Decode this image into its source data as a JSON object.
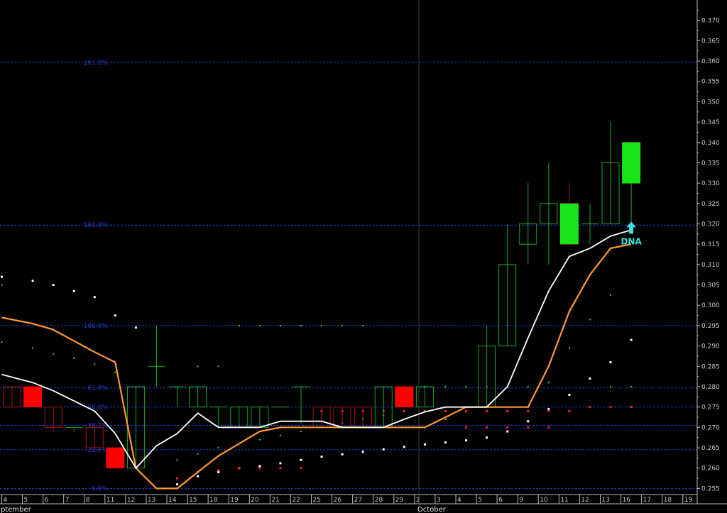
{
  "chart_data": {
    "type": "candlestick",
    "y_axis": {
      "min": 0.2535,
      "max": 0.375,
      "side": "right",
      "ticks": [
        "0.255",
        "0.260",
        "0.265",
        "0.270",
        "0.275",
        "0.280",
        "0.285",
        "0.290",
        "0.295",
        "0.300",
        "0.305",
        "0.310",
        "0.315",
        "0.320",
        "0.325",
        "0.330",
        "0.335",
        "0.340",
        "0.345",
        "0.350",
        "0.355",
        "0.360",
        "0.365",
        "0.370"
      ]
    },
    "x_axis": {
      "labels": [
        "4",
        "5",
        "6",
        "7",
        "8",
        "11",
        "12",
        "13",
        "14",
        "15",
        "18",
        "19",
        "20",
        "21",
        "22",
        "25",
        "26",
        "27",
        "28",
        "29",
        "2",
        "3",
        "4",
        "5",
        "6",
        "9",
        "10",
        "11",
        "12",
        "13",
        "16",
        "17",
        "18",
        "19"
      ],
      "months": [
        {
          "label": "ptember",
          "at": 0
        },
        {
          "label": "October",
          "at": 20
        }
      ]
    },
    "fib_levels": [
      {
        "label": "0.0%",
        "value": 0.255
      },
      {
        "label": "23.6%",
        "value": 0.2645
      },
      {
        "label": "38.2%",
        "value": 0.2705
      },
      {
        "label": "50.0%",
        "value": 0.275
      },
      {
        "label": "61.8%",
        "value": 0.2797
      },
      {
        "label": "100.0%",
        "value": 0.295
      },
      {
        "label": "161.8%",
        "value": 0.3197
      },
      {
        "label": "261.8%",
        "value": 0.3597
      }
    ],
    "candles": [
      {
        "x": 0,
        "o": 0.28,
        "h": 0.28,
        "l": 0.275,
        "c": 0.275
      },
      {
        "x": 1,
        "o": 0.28,
        "h": 0.28,
        "l": 0.275,
        "c": 0.275
      },
      {
        "x": 2,
        "o": 0.275,
        "h": 0.275,
        "l": 0.269,
        "c": 0.27
      },
      {
        "x": 3,
        "o": 0.27,
        "h": 0.27,
        "l": 0.269,
        "c": 0.27
      },
      {
        "x": 4,
        "o": 0.27,
        "h": 0.27,
        "l": 0.265,
        "c": 0.265
      },
      {
        "x": 5,
        "o": 0.265,
        "h": 0.265,
        "l": 0.26,
        "c": 0.26
      },
      {
        "x": 6,
        "o": 0.26,
        "h": 0.28,
        "l": 0.26,
        "c": 0.28
      },
      {
        "x": 7,
        "o": 0.285,
        "h": 0.295,
        "l": 0.28,
        "c": 0.285
      },
      {
        "x": 8,
        "o": 0.28,
        "h": 0.28,
        "l": 0.275,
        "c": 0.28
      },
      {
        "x": 9,
        "o": 0.275,
        "h": 0.28,
        "l": 0.275,
        "c": 0.28
      },
      {
        "x": 10,
        "o": 0.275,
        "h": 0.275,
        "l": 0.27,
        "c": 0.275
      },
      {
        "x": 11,
        "o": 0.27,
        "h": 0.275,
        "l": 0.27,
        "c": 0.275
      },
      {
        "x": 12,
        "o": 0.27,
        "h": 0.275,
        "l": 0.27,
        "c": 0.275
      },
      {
        "x": 13,
        "o": 0.275,
        "h": 0.275,
        "l": 0.275,
        "c": 0.275
      },
      {
        "x": 14,
        "o": 0.28,
        "h": 0.28,
        "l": 0.271,
        "c": 0.28
      },
      {
        "x": 15,
        "o": 0.275,
        "h": 0.275,
        "l": 0.27,
        "c": 0.27
      },
      {
        "x": 16,
        "o": 0.275,
        "h": 0.275,
        "l": 0.27,
        "c": 0.27
      },
      {
        "x": 17,
        "o": 0.275,
        "h": 0.275,
        "l": 0.27,
        "c": 0.27
      },
      {
        "x": 18,
        "o": 0.27,
        "h": 0.28,
        "l": 0.27,
        "c": 0.28
      },
      {
        "x": 19,
        "o": 0.28,
        "h": 0.28,
        "l": 0.275,
        "c": 0.275
      },
      {
        "x": 20,
        "o": 0.275,
        "h": 0.28,
        "l": 0.275,
        "c": 0.28
      },
      {
        "x": 23,
        "o": 0.275,
        "h": 0.295,
        "l": 0.275,
        "c": 0.29
      },
      {
        "x": 24,
        "o": 0.29,
        "h": 0.32,
        "l": 0.29,
        "c": 0.31
      },
      {
        "x": 25,
        "o": 0.315,
        "h": 0.33,
        "l": 0.31,
        "c": 0.32
      },
      {
        "x": 26,
        "o": 0.32,
        "h": 0.335,
        "l": 0.31,
        "c": 0.325
      },
      {
        "x": 27,
        "o": 0.325,
        "h": 0.33,
        "l": 0.315,
        "c": 0.315
      },
      {
        "x": 28,
        "o": 0.32,
        "h": 0.325,
        "l": 0.315,
        "c": 0.32
      },
      {
        "x": 29,
        "o": 0.32,
        "h": 0.345,
        "l": 0.32,
        "c": 0.335
      },
      {
        "x": 30,
        "o": 0.33,
        "h": 0.34,
        "l": 0.32,
        "c": 0.34
      }
    ],
    "highlights": [
      {
        "x": 1,
        "top": 0.28,
        "bottom": 0.275,
        "color": "#ff0000"
      },
      {
        "x": 5,
        "top": 0.265,
        "bottom": 0.26,
        "color": "#ff0000"
      },
      {
        "x": 19,
        "top": 0.28,
        "bottom": 0.275,
        "color": "#ff0000"
      },
      {
        "x": 27,
        "top": 0.325,
        "bottom": 0.315,
        "color": "#19e619"
      },
      {
        "x": 30,
        "top": 0.34,
        "bottom": 0.33,
        "color": "#19e619"
      }
    ],
    "white_line": [
      [
        -0.5,
        0.283
      ],
      [
        1,
        0.281
      ],
      [
        2,
        0.279
      ],
      [
        4,
        0.274
      ],
      [
        5,
        0.2685
      ],
      [
        6,
        0.26
      ],
      [
        7,
        0.2655
      ],
      [
        8,
        0.2685
      ],
      [
        9,
        0.2735
      ],
      [
        10,
        0.27
      ],
      [
        11,
        0.27
      ],
      [
        12,
        0.27
      ],
      [
        13,
        0.2715
      ],
      [
        14,
        0.2715
      ],
      [
        15,
        0.2715
      ],
      [
        16,
        0.27
      ],
      [
        17,
        0.27
      ],
      [
        18,
        0.27
      ],
      [
        19,
        0.272
      ],
      [
        20,
        0.2738
      ],
      [
        21,
        0.275
      ],
      [
        22,
        0.275
      ],
      [
        23,
        0.275
      ],
      [
        24,
        0.28
      ],
      [
        25,
        0.292
      ],
      [
        26,
        0.3035
      ],
      [
        27,
        0.312
      ],
      [
        28,
        0.314
      ],
      [
        29,
        0.317
      ],
      [
        30,
        0.3185
      ]
    ],
    "orange_line": [
      [
        -0.5,
        0.297
      ],
      [
        1,
        0.2955
      ],
      [
        2,
        0.294
      ],
      [
        4,
        0.2885
      ],
      [
        5,
        0.286
      ],
      [
        6,
        0.26
      ],
      [
        7,
        0.255
      ],
      [
        8,
        0.255
      ],
      [
        9,
        0.259
      ],
      [
        10,
        0.263
      ],
      [
        11,
        0.266
      ],
      [
        12,
        0.269
      ],
      [
        13,
        0.27
      ],
      [
        14,
        0.27
      ],
      [
        15,
        0.27
      ],
      [
        16,
        0.27
      ],
      [
        17,
        0.27
      ],
      [
        18,
        0.27
      ],
      [
        19,
        0.27
      ],
      [
        20,
        0.27
      ],
      [
        21,
        0.2725
      ],
      [
        22,
        0.275
      ],
      [
        23,
        0.275
      ],
      [
        24,
        0.275
      ],
      [
        25,
        0.275
      ],
      [
        26,
        0.285
      ],
      [
        27,
        0.2985
      ],
      [
        28,
        0.3075
      ],
      [
        29,
        0.314
      ],
      [
        30,
        0.315
      ]
    ],
    "dots_white": [
      [
        -0.5,
        0.307
      ],
      [
        1,
        0.306
      ],
      [
        2,
        0.305
      ],
      [
        3,
        0.3035
      ],
      [
        4,
        0.302
      ],
      [
        5,
        0.2975
      ],
      [
        6,
        0.2945
      ],
      [
        8,
        0.256
      ],
      [
        9,
        0.258
      ],
      [
        10,
        0.259
      ],
      [
        11,
        0.26
      ],
      [
        12,
        0.2605
      ],
      [
        13,
        0.2612
      ],
      [
        14,
        0.262
      ],
      [
        15,
        0.2628
      ],
      [
        16,
        0.2634
      ],
      [
        17,
        0.264
      ],
      [
        18,
        0.2646
      ],
      [
        19,
        0.2652
      ],
      [
        20,
        0.2658
      ],
      [
        21,
        0.2663
      ],
      [
        22,
        0.2668
      ],
      [
        23,
        0.2675
      ],
      [
        24,
        0.269
      ],
      [
        25,
        0.2715
      ],
      [
        26,
        0.2745
      ],
      [
        27,
        0.278
      ],
      [
        28,
        0.282
      ],
      [
        29,
        0.286
      ],
      [
        30,
        0.2915
      ]
    ],
    "dots_green": [
      [
        -0.5,
        0.305
      ],
      [
        -0.5,
        0.291
      ],
      [
        1,
        0.2895
      ],
      [
        2,
        0.288
      ],
      [
        3,
        0.287
      ],
      [
        4,
        0.2855
      ],
      [
        5,
        0.2835
      ],
      [
        9,
        0.285
      ],
      [
        10,
        0.285
      ],
      [
        11,
        0.295
      ],
      [
        12,
        0.295
      ],
      [
        13,
        0.295
      ],
      [
        14,
        0.295
      ],
      [
        15,
        0.295
      ],
      [
        16,
        0.295
      ],
      [
        17,
        0.295
      ],
      [
        8,
        0.262
      ],
      [
        9,
        0.2635
      ],
      [
        10,
        0.265
      ],
      [
        11,
        0.266
      ],
      [
        12,
        0.267
      ],
      [
        13,
        0.268
      ],
      [
        14,
        0.269
      ],
      [
        15,
        0.27
      ],
      [
        16,
        0.271
      ],
      [
        17,
        0.272
      ],
      [
        18,
        0.273
      ],
      [
        19,
        0.274
      ],
      [
        20,
        0.274
      ],
      [
        21,
        0.272
      ],
      [
        20,
        0.28
      ],
      [
        21,
        0.28
      ],
      [
        22,
        0.28
      ],
      [
        23,
        0.28
      ],
      [
        24,
        0.28
      ],
      [
        25,
        0.28
      ],
      [
        26,
        0.281
      ],
      [
        27,
        0.2895
      ],
      [
        28,
        0.2965
      ],
      [
        29,
        0.28
      ],
      [
        30,
        0.28
      ],
      [
        29,
        0.3025
      ]
    ],
    "dots_red": [
      [
        8,
        0.2575
      ],
      [
        9,
        0.259
      ],
      [
        10,
        0.2595
      ],
      [
        11,
        0.26
      ],
      [
        12,
        0.26
      ],
      [
        13,
        0.26
      ],
      [
        14,
        0.26
      ],
      [
        15,
        0.274
      ],
      [
        16,
        0.274
      ],
      [
        17,
        0.274
      ],
      [
        18,
        0.274
      ],
      [
        19,
        0.274
      ],
      [
        20,
        0.274
      ],
      [
        21,
        0.274
      ],
      [
        22,
        0.274
      ],
      [
        23,
        0.274
      ],
      [
        24,
        0.274
      ],
      [
        25,
        0.274
      ],
      [
        26,
        0.274
      ],
      [
        27,
        0.274
      ],
      [
        28,
        0.275
      ],
      [
        29,
        0.275
      ],
      [
        30,
        0.275
      ],
      [
        22,
        0.27
      ],
      [
        23,
        0.27
      ],
      [
        24,
        0.27
      ],
      [
        25,
        0.27
      ],
      [
        26,
        0.27
      ]
    ],
    "annotation": {
      "x": 30,
      "value": 0.3195,
      "label": "DNA"
    },
    "colors": {
      "bull": "#1aa81a",
      "bear": "#b01010",
      "fib": "#1f3dcc",
      "white_line": "#ffffff",
      "orange_line": "#ff9933",
      "annot": "#3fe0e0"
    }
  }
}
